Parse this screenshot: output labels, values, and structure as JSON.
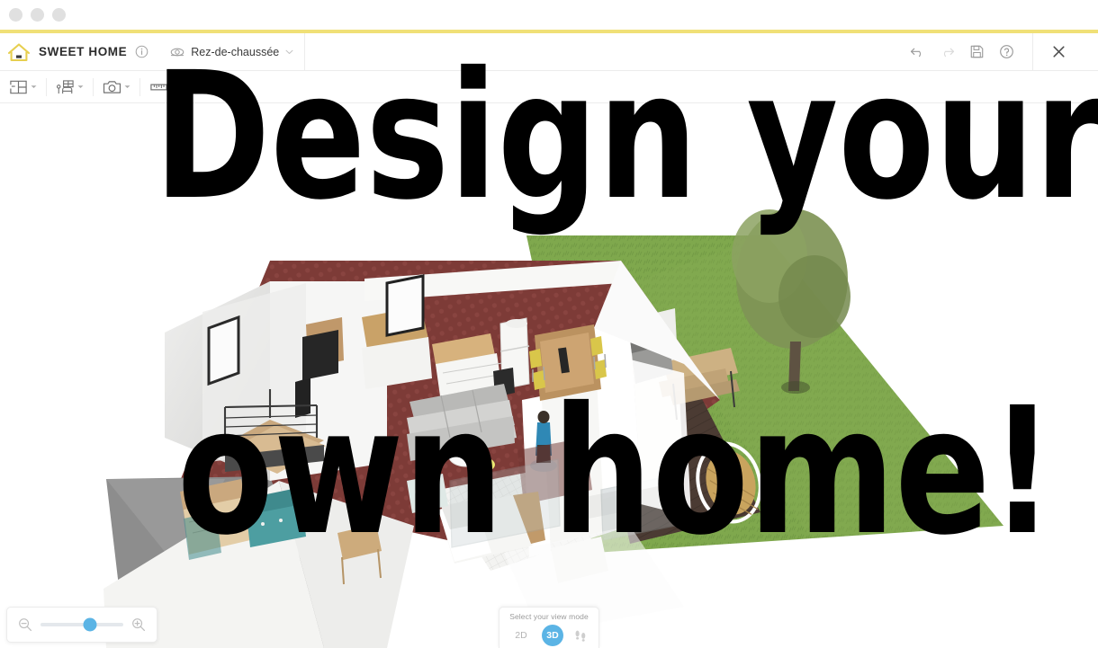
{
  "window": {
    "traffic_lights": [
      "close",
      "minimize",
      "zoom"
    ],
    "accent_color": "#f0e077"
  },
  "header": {
    "logo_icon": "house-logo-icon",
    "brand_name": "SWEET HOME",
    "info_icon": "info-icon",
    "level": {
      "eye_icon": "level-visibility-icon",
      "label": "Rez-de-chaussée",
      "chevron_icon": "chevron-down-icon"
    },
    "actions": [
      {
        "name": "undo-button",
        "icon": "undo-arrow-icon",
        "enabled": true
      },
      {
        "name": "redo-button",
        "icon": "redo-arrow-icon",
        "enabled": false
      },
      {
        "name": "save-button",
        "icon": "floppy-disk-icon",
        "enabled": true
      },
      {
        "name": "help-button",
        "icon": "question-circle-icon",
        "enabled": true
      }
    ],
    "close_icon": "close-x-icon"
  },
  "toolbar": {
    "tools": [
      {
        "name": "walls-tool",
        "icon": "floor-plan-icon",
        "has_dropdown": true
      },
      {
        "name": "furniture-tool",
        "icon": "furniture-icon",
        "has_dropdown": true
      },
      {
        "name": "photo-tool",
        "icon": "camera-icon",
        "has_dropdown": true
      },
      {
        "name": "measure-tool",
        "icon": "ruler-icon",
        "has_dropdown": false
      }
    ]
  },
  "headline": {
    "line1": "Design your",
    "line2": "own home!",
    "color": "#000000"
  },
  "zoom_control": {
    "zoom_out_icon": "magnifier-minus-icon",
    "zoom_in_icon": "magnifier-plus-icon",
    "value_percent": 60,
    "thumb_color": "#5bb4e5"
  },
  "view_mode": {
    "title": "Select your view mode",
    "options": [
      {
        "name": "view-mode-2d",
        "label": "2D",
        "selected": false
      },
      {
        "name": "view-mode-3d",
        "label": "3D",
        "selected": true
      },
      {
        "name": "view-mode-walkthrough",
        "icon": "footprints-icon",
        "selected": false
      }
    ],
    "selected_color": "#5bb4e5"
  },
  "scene": {
    "description": "3D isometric cutaway render of a ground-floor house plan",
    "floor_color": "#7d3b37",
    "wall_color": "#f2f2f0",
    "lawn_color": "#7fa84d",
    "deck_color": "#4b3b33",
    "roof_shadow_color": "#8d8d8d"
  }
}
